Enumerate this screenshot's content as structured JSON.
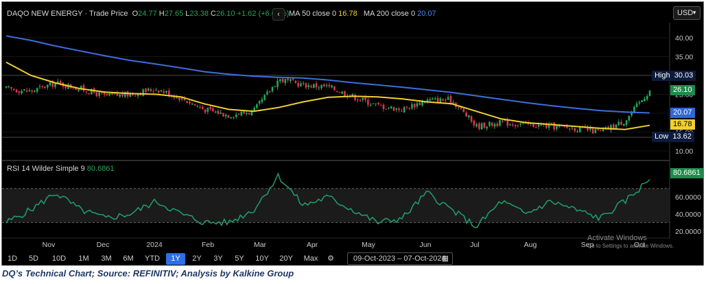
{
  "header": {
    "symbol": "DAQO NEW ENERGY",
    "subtitle": "· Trade Price",
    "o_label": "O",
    "o_value": "24.77",
    "h_label": "H",
    "h_value": "27.65",
    "l_label": "L",
    "l_value": "23.38",
    "c_label": "C",
    "c_value": "26.10",
    "change": "+1.62 (+6.62%)",
    "collapse_icon": "chevron-left-icon",
    "ma50_label": "MA 50 close 0",
    "ma50_value": "16.78",
    "ma200_label": "MA 200 close 0",
    "ma200_value": "20.07",
    "currency": "USD"
  },
  "rsi_header": {
    "label": "RSI 14 Wilder Simple 9",
    "value": "80.6861"
  },
  "price_axis": {
    "ticks": [
      "40.00",
      "35.00",
      "30.00",
      "25.00",
      "20.00",
      "15.00",
      "10.00"
    ]
  },
  "rsi_axis": {
    "ticks": [
      "60.0000",
      "40.0000",
      "20.0000"
    ]
  },
  "badges": {
    "high_label": "High",
    "high_value": "30.03",
    "close_value": "26.10",
    "ma200_value": "20.07",
    "ma50_value": "16.78",
    "low_label": "Low",
    "low_value": "13.62",
    "rsi_value": "80.6861"
  },
  "time_axis": {
    "labels": [
      "Nov",
      "Dec",
      "2024",
      "Feb",
      "Mar",
      "Apr",
      "May",
      "Jun",
      "Jul",
      "Aug",
      "Sep",
      "Oct"
    ]
  },
  "toolbar": {
    "ranges": [
      "1D",
      "5D",
      "10D",
      "1M",
      "3M",
      "6M",
      "YTD",
      "1Y",
      "2Y",
      "3Y",
      "5Y",
      "10Y",
      "20Y",
      "Max"
    ],
    "active": "1Y",
    "settings_icon": "gear-icon",
    "date_from": "09-Oct-2023",
    "date_sep": "–",
    "date_to": "07-Oct-2024",
    "calendar_icon": "calendar-icon"
  },
  "watermark": {
    "line1": "Activate Windows",
    "line2": "Go to Settings to activate Windows."
  },
  "caption": "DQ’s Technical Chart; Source: REFINITIV; Analysis by Kalkine Group",
  "colors": {
    "up": "#26a65b",
    "down": "#e0344b",
    "ma50": "#f1d030",
    "ma200": "#3d6fe0",
    "rsi": "#1fa070",
    "badge_dark": "#0d1b3d"
  },
  "chart_data": [
    {
      "type": "candlestick",
      "subtitle": "Trade Price",
      "x_range": [
        "2023-10-09",
        "2024-10-07"
      ],
      "ylim": [
        8,
        44
      ],
      "reference_levels": {
        "high": 30.03,
        "low": 13.62
      },
      "last": {
        "open": 24.77,
        "high": 27.65,
        "low": 23.38,
        "close": 26.1
      },
      "close_series": {
        "x": [
          "2023-10-09",
          "2023-10-23",
          "2023-11-06",
          "2023-11-20",
          "2023-12-04",
          "2023-12-18",
          "2024-01-02",
          "2024-01-16",
          "2024-01-29",
          "2024-02-12",
          "2024-02-26",
          "2024-03-11",
          "2024-03-25",
          "2024-04-08",
          "2024-04-22",
          "2024-05-06",
          "2024-05-20",
          "2024-06-03",
          "2024-06-17",
          "2024-07-01",
          "2024-07-15",
          "2024-07-29",
          "2024-08-12",
          "2024-08-26",
          "2024-09-09",
          "2024-09-23",
          "2024-10-07"
        ],
        "y": [
          26.5,
          25.8,
          28.0,
          26.5,
          24.5,
          25.0,
          26.5,
          24.0,
          21.0,
          19.5,
          20.5,
          29.0,
          27.5,
          27.0,
          24.5,
          22.0,
          21.0,
          23.5,
          23.5,
          16.5,
          17.5,
          17.0,
          16.5,
          16.0,
          15.0,
          18.0,
          26.1
        ]
      },
      "series": [
        {
          "name": "MA 50 close 0",
          "y": [
            33.5,
            30.0,
            28.0,
            26.5,
            25.6,
            25.2,
            25.0,
            24.3,
            22.5,
            21.0,
            20.5,
            21.5,
            23.0,
            24.2,
            24.5,
            24.3,
            23.8,
            23.0,
            22.5,
            20.5,
            18.5,
            17.5,
            17.0,
            16.5,
            16.0,
            15.7,
            16.78
          ]
        },
        {
          "name": "MA 200 close 0",
          "y": [
            40.5,
            39.3,
            37.8,
            36.5,
            35.2,
            34.0,
            33.0,
            32.0,
            31.0,
            30.3,
            29.8,
            29.5,
            29.3,
            28.8,
            28.1,
            27.5,
            26.9,
            26.2,
            25.5,
            24.6,
            23.7,
            22.8,
            22.0,
            21.3,
            20.7,
            20.3,
            20.07
          ]
        }
      ]
    },
    {
      "type": "line",
      "subtitle": "RSI 14 Wilder Simple 9",
      "ylim": [
        15,
        90
      ],
      "reference_levels": [
        30,
        70
      ],
      "x": [
        "2023-10-09",
        "2023-10-23",
        "2023-11-06",
        "2023-11-20",
        "2023-12-04",
        "2023-12-18",
        "2024-01-02",
        "2024-01-16",
        "2024-01-29",
        "2024-02-12",
        "2024-02-26",
        "2024-03-11",
        "2024-03-25",
        "2024-04-08",
        "2024-04-22",
        "2024-05-06",
        "2024-05-20",
        "2024-06-03",
        "2024-06-17",
        "2024-07-01",
        "2024-07-15",
        "2024-07-29",
        "2024-08-12",
        "2024-08-26",
        "2024-09-09",
        "2024-09-23",
        "2024-10-07"
      ],
      "series": [
        {
          "name": "RSI 14 Wilder Simple 9",
          "y": [
            30,
            45,
            65,
            45,
            35,
            40,
            55,
            40,
            30,
            30,
            45,
            85,
            50,
            60,
            45,
            30,
            35,
            65,
            45,
            25,
            55,
            40,
            55,
            45,
            35,
            55,
            80.69
          ]
        }
      ]
    }
  ]
}
